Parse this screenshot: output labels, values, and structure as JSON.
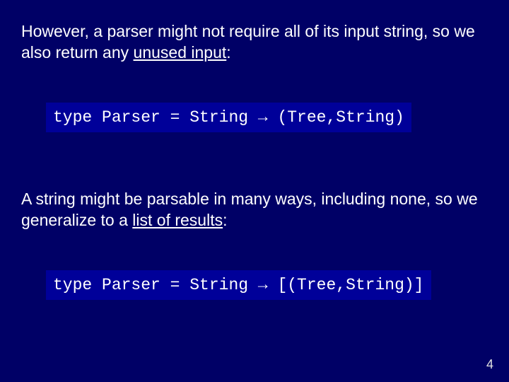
{
  "para1_a": "However, a parser might not require all of its input string, so we also return any ",
  "para1_u": "unused input",
  "para1_b": ":",
  "code1": "type Parser = String → (Tree,String)",
  "para2_a": "A string might be parsable in many ways, including none, so we generalize to a ",
  "para2_u": "list of results",
  "para2_b": ":",
  "code2": "type Parser = String → [(Tree,String)]",
  "pagenum": "4"
}
